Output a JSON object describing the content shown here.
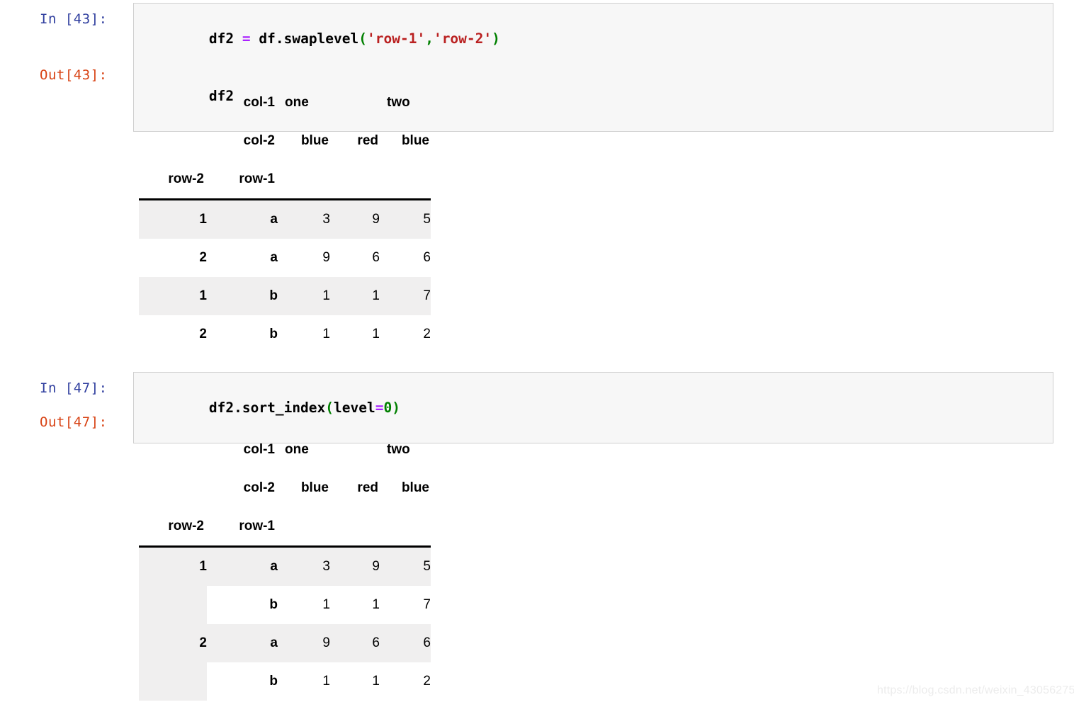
{
  "notebook": {
    "watermark": "https://blog.csdn.net/weixin_43056275",
    "cells": [
      {
        "in_prompt": "In [43]:",
        "out_prompt": "Out[43]:",
        "code_lines": [
          [
            {
              "t": "df2 ",
              "c": "plain"
            },
            {
              "t": "=",
              "c": "op"
            },
            {
              "t": " df.swaplevel",
              "c": "plain"
            },
            {
              "t": "(",
              "c": "punc"
            },
            {
              "t": "'row-1'",
              "c": "str"
            },
            {
              "t": ",",
              "c": "punc"
            },
            {
              "t": "'row-2'",
              "c": "str"
            },
            {
              "t": ")",
              "c": "punc"
            }
          ],
          [
            {
              "t": "df2",
              "c": "plain"
            }
          ]
        ]
      },
      {
        "in_prompt": "In [47]:",
        "out_prompt": "Out[47]:",
        "code_lines": [
          [
            {
              "t": "df2.sort_index",
              "c": "plain"
            },
            {
              "t": "(",
              "c": "punc"
            },
            {
              "t": "level",
              "c": "plain"
            },
            {
              "t": "=",
              "c": "op"
            },
            {
              "t": "0",
              "c": "num"
            },
            {
              "t": ")",
              "c": "punc"
            }
          ]
        ]
      }
    ]
  },
  "table_unsorted": {
    "col_level_names": [
      "col-1",
      "col-2"
    ],
    "col_level_1": [
      "one",
      "two"
    ],
    "col_level_1_spans": [
      2,
      1
    ],
    "col_level_2": [
      "blue",
      "red",
      "blue"
    ],
    "index_names": [
      "row-2",
      "row-1"
    ],
    "rows": [
      {
        "idx0": "1",
        "idx1": "a",
        "values": [
          "3",
          "9",
          "5"
        ],
        "shaded": true
      },
      {
        "idx0": "2",
        "idx1": "a",
        "values": [
          "9",
          "6",
          "6"
        ],
        "shaded": false
      },
      {
        "idx0": "1",
        "idx1": "b",
        "values": [
          "1",
          "1",
          "7"
        ],
        "shaded": true
      },
      {
        "idx0": "2",
        "idx1": "b",
        "values": [
          "1",
          "1",
          "2"
        ],
        "shaded": false
      }
    ]
  },
  "table_sorted": {
    "col_level_names": [
      "col-1",
      "col-2"
    ],
    "col_level_1": [
      "one",
      "two"
    ],
    "col_level_1_spans": [
      2,
      1
    ],
    "col_level_2": [
      "blue",
      "red",
      "blue"
    ],
    "index_names": [
      "row-2",
      "row-1"
    ],
    "rows": [
      {
        "idx0": "1",
        "idx1": "a",
        "values": [
          "3",
          "9",
          "5"
        ],
        "shaded": true
      },
      {
        "idx0": "",
        "idx1": "b",
        "values": [
          "1",
          "1",
          "7"
        ],
        "shaded": false
      },
      {
        "idx0": "2",
        "idx1": "a",
        "values": [
          "9",
          "6",
          "6"
        ],
        "shaded": true
      },
      {
        "idx0": "",
        "idx1": "b",
        "values": [
          "1",
          "1",
          "2"
        ],
        "shaded": false
      }
    ]
  }
}
